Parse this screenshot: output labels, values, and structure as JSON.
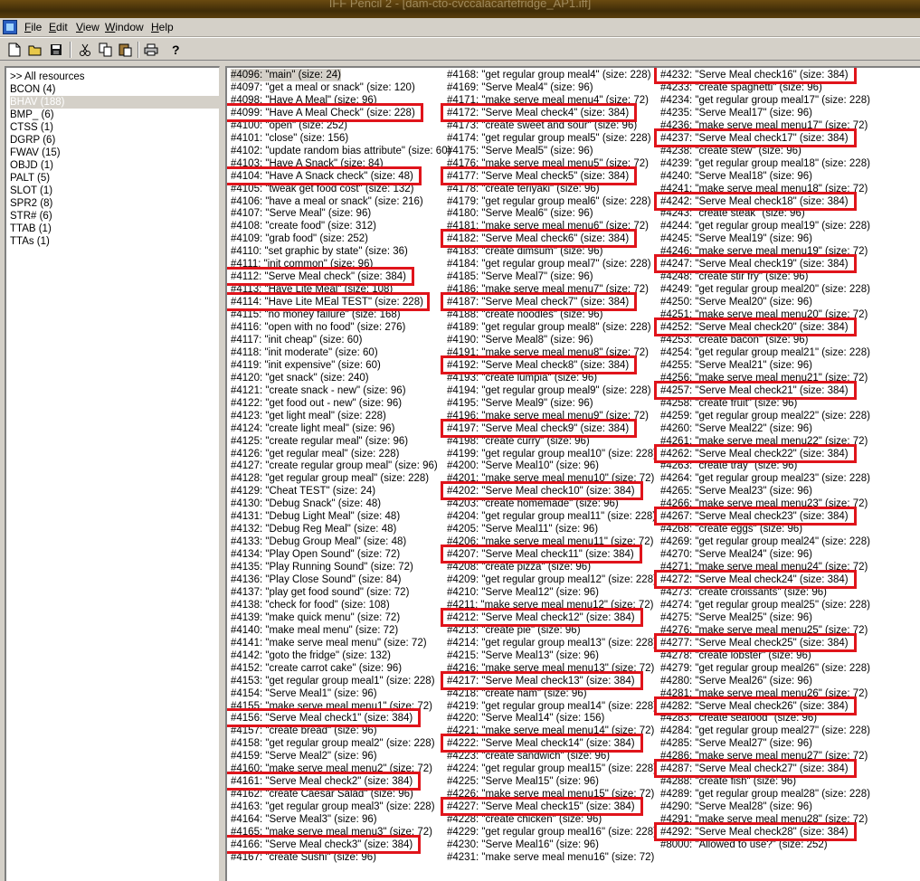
{
  "window": {
    "title": "IFF Pencil 2 - [dam-cto-cvccalacartefridge_AP1.iff]"
  },
  "menu": [
    "File",
    "Edit",
    "View",
    "Window",
    "Help"
  ],
  "toolbar": [
    "new-icon",
    "open-icon",
    "save-icon",
    "cut-icon",
    "copy-icon",
    "paste-icon",
    "print-icon",
    "help-icon"
  ],
  "resources": [
    ">> All resources",
    "BCON (4)",
    "BHAV (188)",
    "BMP_ (6)",
    "CTSS (1)",
    "DGRP (6)",
    "FWAV (15)",
    "OBJD (1)",
    "PALT (5)",
    "SLOT (1)",
    "SPR2 (8)",
    "STR# (6)",
    "TTAB (1)",
    "TTAs (1)"
  ],
  "selected_resource": "BHAV (188)",
  "columns": [
    [
      "#4096: \"main\" (size: 24)",
      "#4097: \"get a meal or snack\" (size: 120)",
      "#4098: \"Have A Meal\" (size: 96)",
      "#4099: \"Have A Meal Check\" (size: 228)",
      "#4100: \"open\" (size: 252)",
      "#4101: \"close\" (size: 156)",
      "#4102: \"update random bias attribute\" (size: 60)",
      "#4103: \"Have A Snack\" (size: 84)",
      "#4104: \"Have A Snack check\" (size: 48)",
      "#4105: \"tweak get food cost\" (size: 132)",
      "#4106: \"have a meal or snack\" (size: 216)",
      "#4107: \"Serve Meal\" (size: 96)",
      "#4108: \"create food\" (size: 312)",
      "#4109: \"grab food\" (size: 252)",
      "#4110: \"set graphic by state\" (size: 36)",
      "#4111: \"init common\" (size: 96)",
      "#4112: \"Serve Meal check\" (size: 384)",
      "#4113: \"Have Lite Meal\" (size: 108)",
      "#4114: \"Have Lite MEal TEST\" (size: 228)",
      "#4115: \"no money failure\" (size: 168)",
      "#4116: \"open with no food\" (size: 276)",
      "#4117: \"init cheap\" (size: 60)",
      "#4118: \"init moderate\" (size: 60)",
      "#4119: \"init expensive\" (size: 60)",
      "#4120: \"get snack\" (size: 240)",
      "#4121: \"create snack - new\" (size: 96)",
      "#4122: \"get food out - new\" (size: 96)",
      "#4123: \"get light meal\" (size: 228)",
      "#4124: \"create light meal\" (size: 96)",
      "#4125: \"create regular meal\" (size: 96)",
      "#4126: \"get regular meal\" (size: 228)",
      "#4127: \"create regular group meal\" (size: 96)",
      "#4128: \"get regular group meal\" (size: 228)",
      "#4129: \"Cheat TEST\" (size: 24)",
      "#4130: \"Debug Snack\" (size: 48)",
      "#4131: \"Debug Light Meal\" (size: 48)",
      "#4132: \"Debug Reg Meal\" (size: 48)",
      "#4133: \"Debug Group Meal\" (size: 48)",
      "#4134: \"Play Open Sound\" (size: 72)",
      "#4135: \"Play Running Sound\" (size: 72)",
      "#4136: \"Play Close Sound\" (size: 84)",
      "#4137: \"play get food sound\" (size: 72)",
      "#4138: \"check for food\" (size: 108)",
      "#4139: \"make quick menu\" (size: 72)",
      "#4140: \"make meal menu\" (size: 72)",
      "#4141: \"make serve meal menu\" (size: 72)",
      "#4142: \"goto the fridge\" (size: 132)",
      "#4152: \"create carrot cake\" (size: 96)",
      "#4153: \"get regular group meal1\" (size: 228)",
      "#4154: \"Serve Meal1\" (size: 96)",
      "#4155: \"make serve meal menu1\" (size: 72)",
      "#4156: \"Serve Meal check1\" (size: 384)",
      "#4157: \"create bread\" (size: 96)",
      "#4158: \"get regular group meal2\" (size: 228)",
      "#4159: \"Serve Meal2\" (size: 96)",
      "#4160: \"make serve meal menu2\" (size: 72)",
      "#4161: \"Serve Meal check2\" (size: 384)",
      "#4162: \"create Caesar Salad\" (size: 96)",
      "#4163: \"get regular group meal3\" (size: 228)",
      "#4164: \"Serve Meal3\" (size: 96)",
      "#4165: \"make serve meal menu3\" (size: 72)",
      "#4166: \"Serve Meal check3\" (size: 384)",
      "#4167: \"create Sushi\" (size: 96)"
    ],
    [
      "#4168: \"get regular group meal4\" (size: 228)",
      "#4169: \"Serve Meal4\" (size: 96)",
      "#4171: \"make serve meal menu4\" (size: 72)",
      "#4172: \"Serve Meal check4\" (size: 384)",
      "#4173: \"create sweet and sour\" (size: 96)",
      "#4174: \"get regular group meal5\" (size: 228)",
      "#4175: \"Serve Meal5\" (size: 96)",
      "#4176: \"make serve meal menu5\" (size: 72)",
      "#4177: \"Serve Meal check5\" (size: 384)",
      "#4178: \"create teriyaki\" (size: 96)",
      "#4179: \"get regular group meal6\" (size: 228)",
      "#4180: \"Serve Meal6\" (size: 96)",
      "#4181: \"make serve meal menu6\" (size: 72)",
      "#4182: \"Serve Meal check6\" (size: 384)",
      "#4183: \"create dimsum\" (size: 96)",
      "#4184: \"get regular group meal7\" (size: 228)",
      "#4185: \"Serve Meal7\" (size: 96)",
      "#4186: \"make serve meal menu7\" (size: 72)",
      "#4187: \"Serve Meal check7\" (size: 384)",
      "#4188: \"create noodles\" (size: 96)",
      "#4189: \"get regular group meal8\" (size: 228)",
      "#4190: \"Serve Meal8\" (size: 96)",
      "#4191: \"make serve meal menu8\" (size: 72)",
      "#4192: \"Serve Meal check8\" (size: 384)",
      "#4193: \"create lumpia\" (size: 96)",
      "#4194: \"get regular group meal9\" (size: 228)",
      "#4195: \"Serve Meal9\" (size: 96)",
      "#4196: \"make serve meal menu9\" (size: 72)",
      "#4197: \"Serve Meal check9\" (size: 384)",
      "#4198: \"create curry\" (size: 96)",
      "#4199: \"get regular group meal10\" (size: 228)",
      "#4200: \"Serve Meal10\" (size: 96)",
      "#4201: \"make serve meal menu10\" (size: 72)",
      "#4202: \"Serve Meal check10\" (size: 384)",
      "#4203: \"create homemade\" (size: 96)",
      "#4204: \"get regular group meal11\" (size: 228)",
      "#4205: \"Serve Meal11\" (size: 96)",
      "#4206: \"make serve meal menu11\" (size: 72)",
      "#4207: \"Serve Meal check11\" (size: 384)",
      "#4208: \"create pizza\" (size: 96)",
      "#4209: \"get regular group meal12\" (size: 228)",
      "#4210: \"Serve Meal12\" (size: 96)",
      "#4211: \"make serve meal menu12\" (size: 72)",
      "#4212: \"Serve Meal check12\" (size: 384)",
      "#4213: \"create pie\" (size: 96)",
      "#4214: \"get regular group meal13\" (size: 228)",
      "#4215: \"Serve Meal13\" (size: 96)",
      "#4216: \"make serve meal menu13\" (size: 72)",
      "#4217: \"Serve Meal check13\" (size: 384)",
      "#4218: \"create ham\" (size: 96)",
      "#4219: \"get regular group meal14\" (size: 228)",
      "#4220: \"Serve Meal14\" (size: 156)",
      "#4221: \"make serve meal menu14\" (size: 72)",
      "#4222: \"Serve Meal check14\" (size: 384)",
      "#4223: \"create sandwich\" (size: 96)",
      "#4224: \"get regular group meal15\" (size: 228)",
      "#4225: \"Serve Meal15\" (size: 96)",
      "#4226: \"make serve meal menu15\" (size: 72)",
      "#4227: \"Serve Meal check15\" (size: 384)",
      "#4228: \"create chicken\" (size: 96)",
      "#4229: \"get regular group meal16\" (size: 228)",
      "#4230: \"Serve Meal16\" (size: 96)",
      "#4231: \"make serve meal menu16\" (size: 72)"
    ],
    [
      "#4232: \"Serve Meal check16\" (size: 384)",
      "#4233: \"create spaghetti\" (size: 96)",
      "#4234: \"get regular group meal17\" (size: 228)",
      "#4235: \"Serve Meal17\" (size: 96)",
      "#4236: \"make serve meal menu17\" (size: 72)",
      "#4237: \"Serve Meal check17\" (size: 384)",
      "#4238: \"create stew\" (size: 96)",
      "#4239: \"get regular group meal18\" (size: 228)",
      "#4240: \"Serve Meal18\" (size: 96)",
      "#4241: \"make serve meal menu18\" (size: 72)",
      "#4242: \"Serve Meal check18\" (size: 384)",
      "#4243: \"create steak\" (size: 96)",
      "#4244: \"get regular group meal19\" (size: 228)",
      "#4245: \"Serve Meal19\" (size: 96)",
      "#4246: \"make serve meal menu19\" (size: 72)",
      "#4247: \"Serve Meal check19\" (size: 384)",
      "#4248: \"create stir fry\" (size: 96)",
      "#4249: \"get regular group meal20\" (size: 228)",
      "#4250: \"Serve Meal20\" (size: 96)",
      "#4251: \"make serve meal menu20\" (size: 72)",
      "#4252: \"Serve Meal check20\" (size: 384)",
      "#4253: \"create bacon\" (size: 96)",
      "#4254: \"get regular group meal21\" (size: 228)",
      "#4255: \"Serve Meal21\" (size: 96)",
      "#4256: \"make serve meal menu21\" (size: 72)",
      "#4257: \"Serve Meal check21\" (size: 384)",
      "#4258: \"create fruit\" (size: 96)",
      "#4259: \"get regular group meal22\" (size: 228)",
      "#4260: \"Serve Meal22\" (size: 96)",
      "#4261: \"make serve meal menu22\" (size: 72)",
      "#4262: \"Serve Meal check22\" (size: 384)",
      "#4263: \"create tray\" (size: 96)",
      "#4264: \"get regular group meal23\" (size: 228)",
      "#4265: \"Serve Meal23\" (size: 96)",
      "#4266: \"make serve meal menu23\" (size: 72)",
      "#4267: \"Serve Meal check23\" (size: 384)",
      "#4268: \"create eggs\" (size: 96)",
      "#4269: \"get regular group meal24\" (size: 228)",
      "#4270: \"Serve Meal24\" (size: 96)",
      "#4271: \"make serve meal menu24\" (size: 72)",
      "#4272: \"Serve Meal check24\" (size: 384)",
      "#4273: \"create croissants\" (size: 96)",
      "#4274: \"get regular group meal25\" (size: 228)",
      "#4275: \"Serve Meal25\" (size: 96)",
      "#4276: \"make serve meal menu25\" (size: 72)",
      "#4277: \"Serve Meal check25\" (size: 384)",
      "#4278: \"create lobster\" (size: 96)",
      "#4279: \"get regular group meal26\" (size: 228)",
      "#4280: \"Serve Meal26\" (size: 96)",
      "#4281: \"make serve meal menu26\" (size: 72)",
      "#4282: \"Serve Meal check26\" (size: 384)",
      "#4283: \"create seafood\" (size: 96)",
      "#4284: \"get regular group meal27\" (size: 228)",
      "#4285: \"Serve Meal27\" (size: 96)",
      "#4286: \"make serve meal menu27\" (size: 72)",
      "#4287: \"Serve Meal check27\" (size: 384)",
      "#4288: \"create fish\" (size: 96)",
      "#4289: \"get regular group meal28\" (size: 228)",
      "#4290: \"Serve Meal28\" (size: 96)",
      "#4291: \"make serve meal menu28\" (size: 72)",
      "#4292: \"Serve Meal check28\" (size: 384)",
      "#8000: \"Allowed to use?\" (size: 252)"
    ]
  ],
  "selected_entry": "#4096: \"main\" (size: 24)",
  "highlighted_entries": [
    "#4099",
    "#4104",
    "#4112",
    "#4114",
    "#4156",
    "#4161",
    "#4166",
    "#4172",
    "#4177",
    "#4182",
    "#4187",
    "#4192",
    "#4197",
    "#4202",
    "#4207",
    "#4212",
    "#4217",
    "#4222",
    "#4227",
    "#4232",
    "#4237",
    "#4242",
    "#4247",
    "#4252",
    "#4257",
    "#4262",
    "#4267",
    "#4272",
    "#4277",
    "#4282",
    "#4287",
    "#4292"
  ],
  "highlight_color": "#e0141b"
}
